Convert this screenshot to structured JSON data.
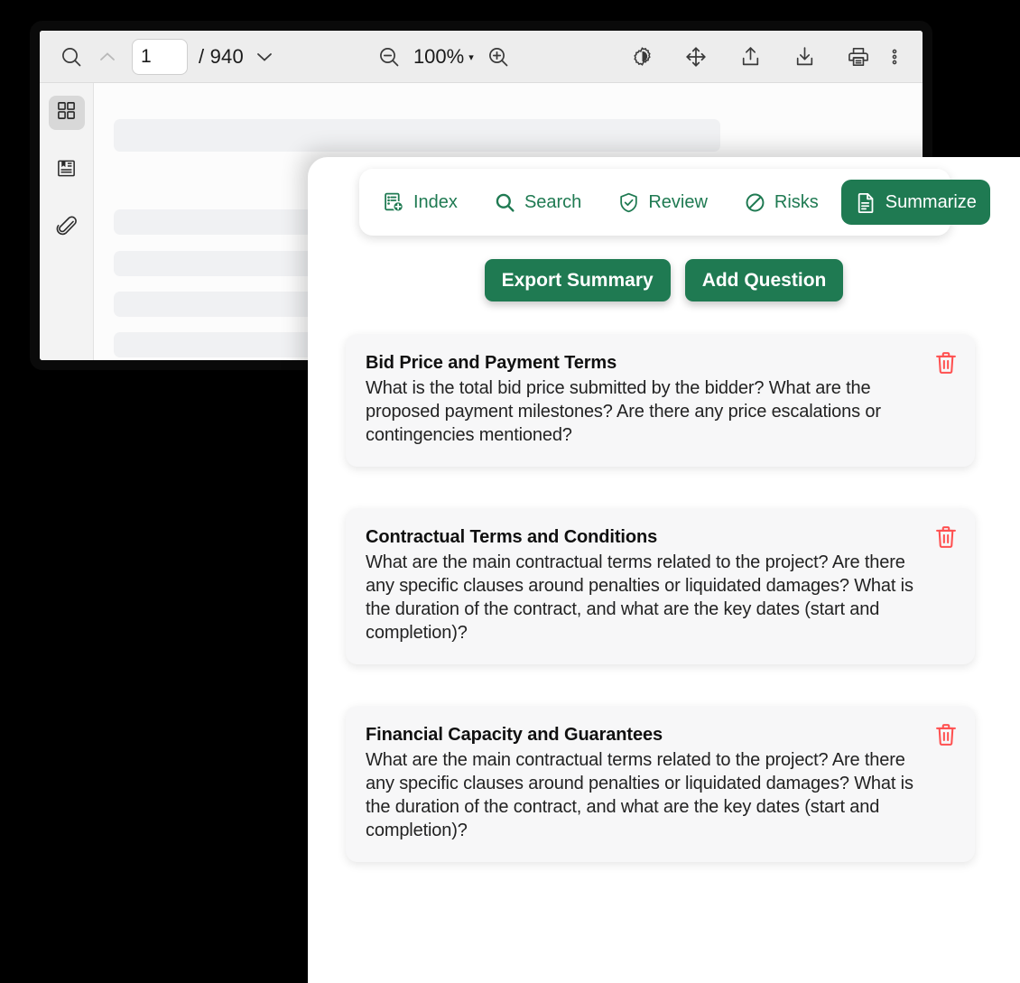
{
  "viewer": {
    "toolbar": {
      "search_icon": "search-icon",
      "prev_page_icon": "chevron-up-icon",
      "page_value": "1",
      "page_placeholder": "1",
      "page_total": "/ 940",
      "next_page_icon": "chevron-down-icon",
      "zoom_out_icon": "zoom-out-icon",
      "zoom_level": "100%",
      "zoom_caret": "▾",
      "zoom_in_icon": "zoom-in-icon",
      "brightness_icon": "brightness-contrast-icon",
      "pan_icon": "move-arrows-icon",
      "upload_icon": "upload-icon",
      "download_icon": "download-icon",
      "print_icon": "print-icon",
      "more_icon": "more-vertical-icon"
    },
    "rail": [
      {
        "name": "thumbnails-icon",
        "active": true
      },
      {
        "name": "outline-icon",
        "active": false
      },
      {
        "name": "attachments-icon",
        "active": false
      }
    ]
  },
  "panel": {
    "tabs": [
      {
        "label": "Index",
        "icon": "index-add-icon",
        "active": false
      },
      {
        "label": "Search",
        "icon": "search-icon",
        "active": false
      },
      {
        "label": "Review",
        "icon": "shield-check-icon",
        "active": false
      },
      {
        "label": "Risks",
        "icon": "ban-icon",
        "active": false
      },
      {
        "label": "Summarize",
        "icon": "document-icon",
        "active": true
      }
    ],
    "actions": [
      {
        "label": "Export Summary"
      },
      {
        "label": "Add Question"
      }
    ],
    "delete_icon": "trash-icon",
    "cards": [
      {
        "title": "Bid Price and Payment Terms",
        "text": "What is the total bid price submitted by the bidder? What are the proposed payment milestones? Are there any price escalations or contingencies mentioned?"
      },
      {
        "title": "Contractual Terms and Conditions",
        "text": "What are the main contractual terms related to the project? Are there any specific clauses around penalties or liquidated damages? What is the duration of the contract, and what are the key dates (start and completion)?"
      },
      {
        "title": "Financial Capacity and Guarantees",
        "text": "What are the main contractual terms related to the project? Are there any specific clauses around penalties or liquidated damages? What is the duration of the contract, and what are the key dates (start and completion)?"
      }
    ]
  },
  "colors": {
    "brand_green": "#1f7a52",
    "delete_red": "#ff5050",
    "toolbar_bg": "#ededed",
    "card_bg": "#f7f7f8",
    "skeleton": "#f0f1f3",
    "page_bg": "#000000"
  }
}
